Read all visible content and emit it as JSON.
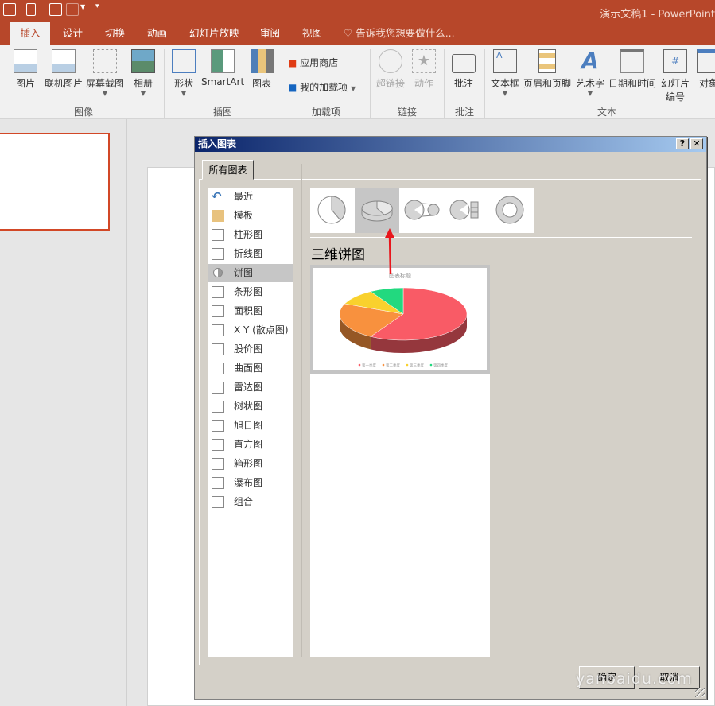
{
  "window": {
    "title": "演示文稿1 - PowerPoint"
  },
  "ribbon_tabs": [
    {
      "label": "插入",
      "active": true
    },
    {
      "label": "设计"
    },
    {
      "label": "切换"
    },
    {
      "label": "动画"
    },
    {
      "label": "幻灯片放映"
    },
    {
      "label": "审阅"
    },
    {
      "label": "视图"
    }
  ],
  "tell_me": "告诉我您想要做什么...",
  "ribbon": {
    "groups": {
      "images": "图像",
      "illustrations": "插图",
      "addins": "加载项",
      "links": "链接",
      "comments": "批注",
      "text": "文本"
    },
    "buttons": {
      "picture": "图片",
      "online_picture": "联机图片",
      "screenshot": "屏幕截图",
      "album": "相册",
      "shapes": "形状",
      "smartart": "SmartArt",
      "chart": "图表",
      "store": "应用商店",
      "my_addins": "我的加载项",
      "hyperlink": "超链接",
      "action": "动作",
      "comment": "批注",
      "textbox": "文本框",
      "header_footer": "页眉和页脚",
      "wordart": "艺术字",
      "datetime": "日期和时间",
      "slide_number_1": "幻灯片",
      "slide_number_2": "编号",
      "object": "对象"
    }
  },
  "dialog": {
    "title": "插入图表",
    "help": "?",
    "close": "✕",
    "tab": "所有图表",
    "categories": [
      {
        "label": "最近",
        "icon": "undo-icon"
      },
      {
        "label": "模板",
        "icon": "folder-icon"
      },
      {
        "label": "柱形图",
        "icon": "column-chart-icon"
      },
      {
        "label": "折线图",
        "icon": "line-chart-icon"
      },
      {
        "label": "饼图",
        "icon": "pie-chart-icon",
        "selected": true
      },
      {
        "label": "条形图",
        "icon": "bar-chart-icon"
      },
      {
        "label": "面积图",
        "icon": "area-chart-icon"
      },
      {
        "label": "X Y (散点图)",
        "icon": "scatter-chart-icon"
      },
      {
        "label": "股价图",
        "icon": "stock-chart-icon"
      },
      {
        "label": "曲面图",
        "icon": "surface-chart-icon"
      },
      {
        "label": "雷达图",
        "icon": "radar-chart-icon"
      },
      {
        "label": "树状图",
        "icon": "treemap-icon"
      },
      {
        "label": "旭日图",
        "icon": "sunburst-icon"
      },
      {
        "label": "直方图",
        "icon": "histogram-icon"
      },
      {
        "label": "箱形图",
        "icon": "box-whisker-icon"
      },
      {
        "label": "瀑布图",
        "icon": "waterfall-icon"
      },
      {
        "label": "组合",
        "icon": "combo-chart-icon"
      }
    ],
    "subtypes": [
      "pie",
      "3d-pie",
      "pie-of-pie",
      "bar-of-pie",
      "doughnut"
    ],
    "selected_subtype": "3d-pie",
    "subtype_name": "三维饼图",
    "ok": "确定",
    "cancel": "取消"
  },
  "chart_data": {
    "type": "pie",
    "variant": "3d",
    "title": "图表标题",
    "categories": [
      "第一季度",
      "第二季度",
      "第三季度",
      "第四季度"
    ],
    "values": [
      8.2,
      3.2,
      1.4,
      1.2
    ],
    "colors": [
      "#F95B66",
      "#F8913E",
      "#F9D12D",
      "#22D97F"
    ],
    "legend": "bottom"
  },
  "watermark": "yanbaidu.com",
  "colors": {
    "accent": "#B7472A",
    "dialog_bg": "#D4D0C8",
    "selection": "#C6C6C6"
  }
}
